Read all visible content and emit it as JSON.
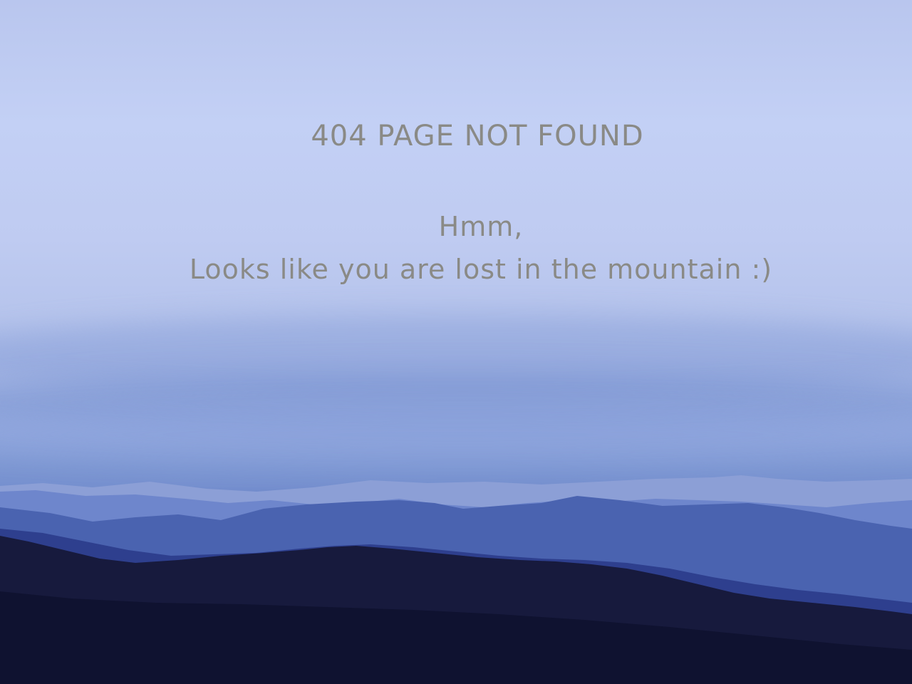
{
  "error": {
    "title": "404 PAGE NOT FOUND",
    "message_line1": "Hmm,",
    "message_line2": "Looks like you are lost in the mountain :)"
  },
  "colors": {
    "text": "#8a8a86",
    "sky_top": "#b9c6ee",
    "far_ridge": "#8c9fd6",
    "mid_ridge": "#4a63b0",
    "near_ridge": "#2a3a86",
    "foreground": "#151838"
  }
}
